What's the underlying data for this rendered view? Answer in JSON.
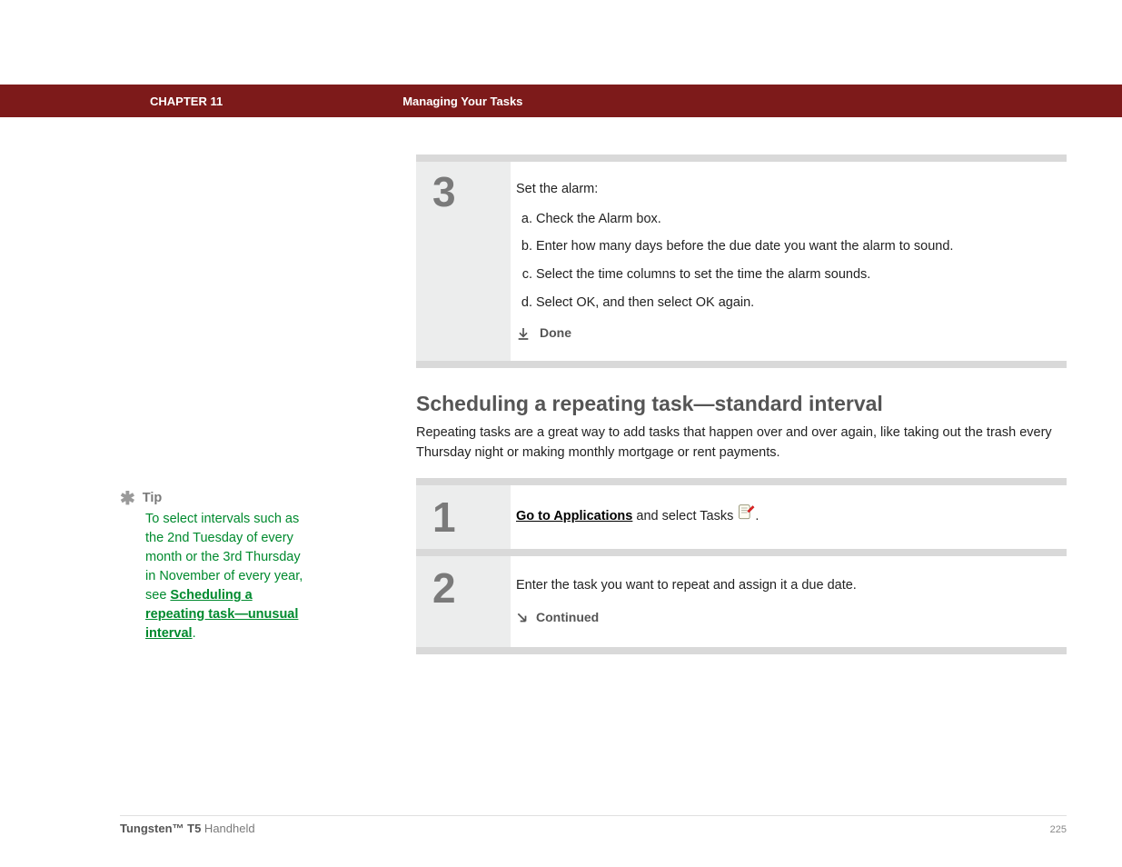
{
  "header": {
    "chapter": "CHAPTER 11",
    "title": "Managing Your Tasks"
  },
  "step3": {
    "num": "3",
    "intro": "Set the alarm:",
    "a": "Check the Alarm box.",
    "b": "Enter how many days before the due date you want the alarm to sound.",
    "c": "Select the time columns to set the time the alarm sounds.",
    "d": "Select OK, and then select OK again.",
    "done": "Done"
  },
  "section": {
    "heading": "Scheduling a repeating task—standard interval",
    "para": "Repeating tasks are a great way to add tasks that happen over and over again, like taking out the trash every Thursday night or making monthly mortgage or rent payments."
  },
  "step1": {
    "num": "1",
    "link": "Go to Applications",
    "rest": " and select Tasks ",
    "period": "."
  },
  "step2": {
    "num": "2",
    "text": "Enter the task you want to repeat and assign it a due date.",
    "continued": "Continued"
  },
  "tip": {
    "label": "Tip",
    "body_before": "To select intervals such as the 2nd Tuesday of every month or the 3rd Thursday in November of every year, see ",
    "link": "Scheduling a repeating task—unusual interval",
    "body_after": "."
  },
  "footer": {
    "product_bold": "Tungsten™ T5",
    "product_rest": " Handheld",
    "page": "225"
  }
}
